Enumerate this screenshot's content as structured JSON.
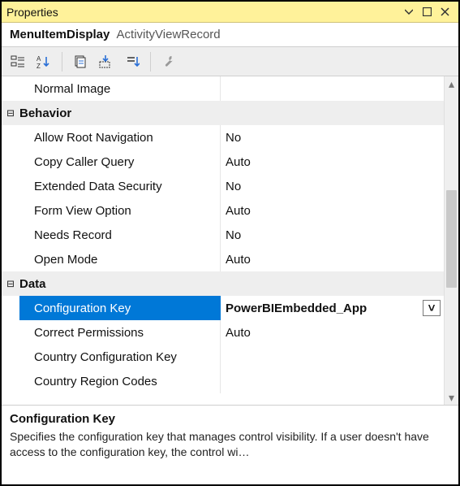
{
  "titlebar": {
    "title": "Properties"
  },
  "object": {
    "type": "MenuItemDisplay",
    "name": "ActivityViewRecord"
  },
  "grid": {
    "rows": [
      {
        "kind": "prop",
        "name": "Normal Image",
        "value": ""
      },
      {
        "kind": "cat",
        "name": "Behavior"
      },
      {
        "kind": "prop",
        "name": "Allow Root Navigation",
        "value": "No"
      },
      {
        "kind": "prop",
        "name": "Copy Caller Query",
        "value": "Auto"
      },
      {
        "kind": "prop",
        "name": "Extended Data Security",
        "value": "No"
      },
      {
        "kind": "prop",
        "name": "Form View Option",
        "value": "Auto"
      },
      {
        "kind": "prop",
        "name": "Needs Record",
        "value": "No"
      },
      {
        "kind": "prop",
        "name": "Open Mode",
        "value": "Auto"
      },
      {
        "kind": "cat",
        "name": "Data"
      },
      {
        "kind": "prop",
        "name": "Configuration Key",
        "value": "PowerBIEmbedded_App",
        "selected": true
      },
      {
        "kind": "prop",
        "name": "Correct Permissions",
        "value": "Auto"
      },
      {
        "kind": "prop",
        "name": "Country Configuration Key",
        "value": ""
      },
      {
        "kind": "prop",
        "name": "Country Region Codes",
        "value": ""
      }
    ]
  },
  "help": {
    "name": "Configuration Key",
    "description": "Specifies the configuration key that manages control visibility. If a user doesn't have access to the configuration key, the control wi…"
  },
  "glyphs": {
    "collapse": "⊟",
    "dropdown": "˅",
    "scroll_up": "▴",
    "scroll_down": "▾"
  }
}
